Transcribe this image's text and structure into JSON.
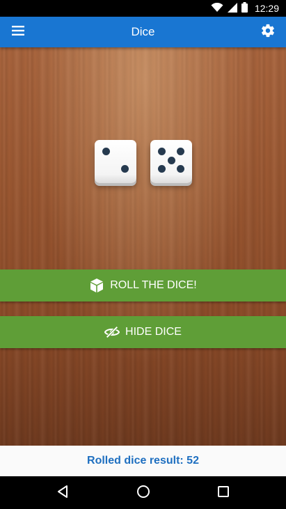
{
  "status_bar": {
    "time": "12:29",
    "icons": [
      "wifi-icon",
      "signal-icon",
      "battery-icon"
    ]
  },
  "app_bar": {
    "title": "Dice",
    "menu_icon": "menu-icon",
    "settings_icon": "gear-icon"
  },
  "dice": [
    {
      "value": 2
    },
    {
      "value": 5
    }
  ],
  "buttons": {
    "roll": {
      "label": "ROLL THE DICE!",
      "icon": "cube-icon"
    },
    "hide": {
      "label": "HIDE DICE",
      "icon": "eye-slash-icon"
    }
  },
  "result": {
    "text": "Rolled dice result: 52"
  },
  "nav_bar": {
    "icons": [
      "back-icon",
      "home-icon",
      "recents-icon"
    ]
  },
  "colors": {
    "app_bar": "#1976d2",
    "button": "#5f9e37",
    "result_text": "#1e6fc0",
    "pip": "#263a4f"
  }
}
